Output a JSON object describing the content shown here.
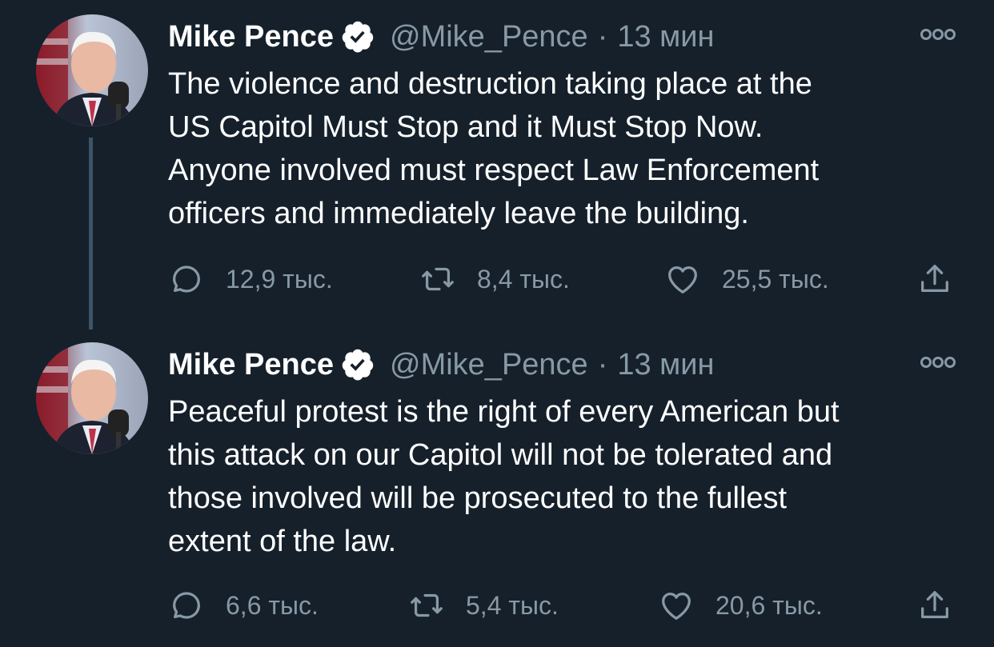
{
  "tweets": [
    {
      "author_name": "Mike Pence",
      "handle": "@Mike_Pence",
      "separator": "·",
      "time": "13 мин",
      "lines": [
        "The violence and destruction taking place at the",
        "US Capitol Must Stop and it Must Stop Now.",
        "Anyone involved must respect Law Enforcement",
        "officers and immediately leave the building."
      ],
      "replies": "12,9 тыс.",
      "retweets": "8,4 тыс.",
      "likes": "25,5 тыс."
    },
    {
      "author_name": "Mike Pence",
      "handle": "@Mike_Pence",
      "separator": "·",
      "time": "13 мин",
      "lines": [
        "Peaceful protest is the right of every American but",
        "this attack on our Capitol will not be tolerated and",
        "those involved will be prosecuted to the fullest",
        "extent of the law."
      ],
      "replies": "6,6 тыс.",
      "retweets": "5,4 тыс.",
      "likes": "20,6 тыс."
    }
  ],
  "icons": {
    "verified": "verified-badge-icon",
    "more": "more-options-icon",
    "reply": "reply-bubble-icon",
    "retweet": "retweet-icon",
    "like": "heart-icon",
    "share": "share-icon"
  },
  "colors": {
    "background": "#15202b",
    "text": "#ffffff",
    "secondary": "#8899a6",
    "thread_line": "#3d5466"
  }
}
